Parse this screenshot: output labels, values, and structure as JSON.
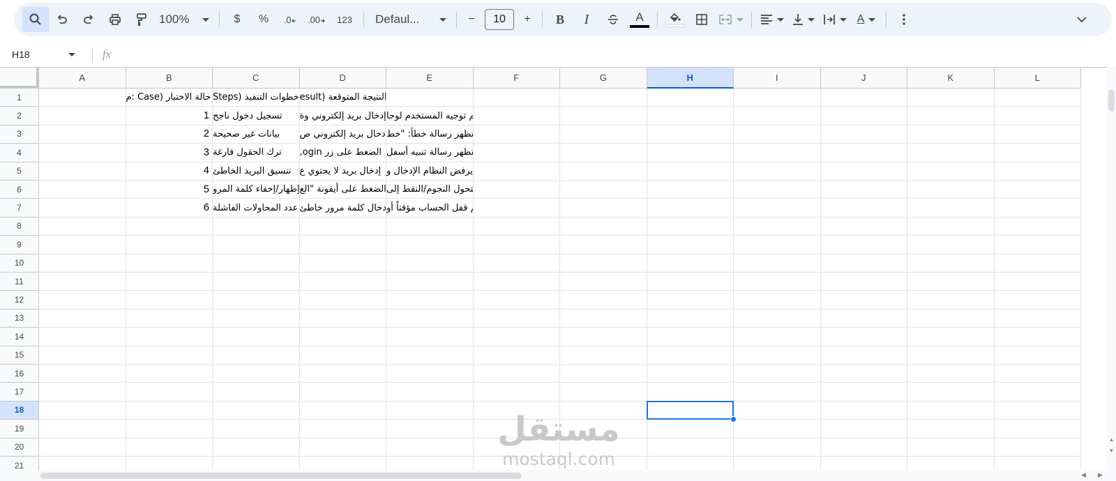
{
  "toolbar": {
    "zoom": "100%",
    "currency": "$",
    "percent": "%",
    "decrease_decimal": ".0",
    "increase_decimal": ".00",
    "format_number": "123",
    "font_family": "Defaul...",
    "font_size": "10",
    "minus": "−",
    "plus": "+",
    "bold": "B",
    "italic": "I",
    "text_color": "A",
    "text_rotation": "A"
  },
  "formula_bar": {
    "cell_ref": "H18",
    "fx": "fx",
    "value": ""
  },
  "sheet": {
    "columns": [
      "A",
      "B",
      "C",
      "D",
      "E",
      "F",
      "G",
      "H",
      "I",
      "J",
      "K",
      "L"
    ],
    "selected_column": "H",
    "rows": [
      "1",
      "2",
      "3",
      "4",
      "5",
      "6",
      "7",
      "8",
      "9",
      "10",
      "11",
      "12",
      "13",
      "14",
      "15",
      "16",
      "17",
      "18",
      "19",
      "20",
      "21"
    ],
    "selected_row": "18",
    "cells": {
      "B1": "حالة الاختبار (Case :م",
      "C1": "خطوات التنفيذ (Steps",
      "D1": "النتيجة المتوقعة (esult",
      "B2": "1",
      "C2": "تسجيل دخول ناجح",
      "D2": "إدخال بريد إلكتروني وة",
      "E2": "يتم توجيه المستخدم لوحا",
      "B3": "2",
      "C3": "بيانات غير صحيحة",
      "D3": "إدخال بريد إلكتروني ص",
      "E3": "تظهر رسالة خطأ: \"خط",
      "B4": "3",
      "C4": "ترك الحقول فارغة",
      "D4": "الضغط على زر ogin,",
      "E4": "تظهر رسالة تنبيه أسفل",
      "B5": "4",
      "C5": "تنسيق البريد الخاطئ",
      "D5": "إدخال بريد لا يحتوي ع",
      "E5": "يرفض النظام الإدخال و",
      "B6": "5",
      "C6": "إظهار/إخفاء كلمة المرو",
      "D6": "الضغط على أيقونة \"الع",
      "E6": "تتحول النجوم/النقط إلى",
      "B7": "6",
      "C7": "عدد المحاولات الفاشلة",
      "D7": "إدخال كلمة مرور خاطئ",
      "E7": "يتم قفل الحساب مؤقتاً أو"
    }
  },
  "watermark": {
    "logo": "مستقل",
    "url": "mostaql.com"
  },
  "icons": {
    "search": "search-icon",
    "undo": "undo-icon",
    "redo": "redo-icon",
    "print": "print-icon",
    "paint_format": "paint-format-icon",
    "strikethrough": "strikethrough-icon",
    "fill_color": "fill-color-icon",
    "borders": "borders-icon",
    "merge": "merge-cells-icon",
    "align": "horizontal-align-icon",
    "valign": "vertical-align-icon",
    "wrap": "text-wrap-icon",
    "more": "more-vert-icon",
    "collapse": "chevron-down-icon"
  },
  "colors": {
    "accent": "#1a73e8",
    "toolbar_bg": "#eef2f9",
    "selected_header_bg": "#d3e3fd",
    "text_color_bar": "#000000"
  }
}
